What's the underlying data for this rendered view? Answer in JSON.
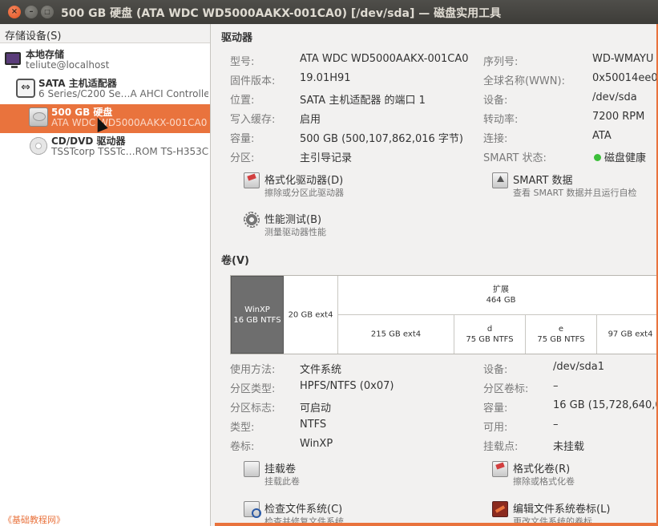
{
  "window": {
    "title": "500 GB 硬盘 (ATA WDC WD5000AAKX-001CA0) [/dev/sda] — 磁盘实用工具",
    "close_glyph": "×",
    "min_glyph": "–",
    "max_glyph": "□"
  },
  "sidebar": {
    "header": "存储设备(S)",
    "items": [
      {
        "title": "本地存储",
        "subtitle": "teliute@localhost",
        "icon": "monitor-icon"
      },
      {
        "title": "SATA 主机适配器",
        "subtitle": "6 Series/C200 Se…A AHCI Controller",
        "icon": "sata-adapter-icon"
      },
      {
        "title": "500 GB 硬盘",
        "subtitle": "ATA WDC WD5000AAKX-001CA0",
        "icon": "hard-disk-icon"
      },
      {
        "title": "CD/DVD 驱动器",
        "subtitle": "TSSTcorp TSSTc…ROM TS-H353C",
        "icon": "cdrom-icon"
      }
    ],
    "selected_index": 2,
    "sata_glyph": "⇔"
  },
  "drive": {
    "section_title": "驱动器",
    "left": [
      {
        "k": "型号:",
        "v": "ATA WDC WD5000AAKX-001CA0"
      },
      {
        "k": "固件版本:",
        "v": "19.01H91"
      },
      {
        "k": "位置:",
        "v": "SATA 主机适配器 的端口 1"
      },
      {
        "k": "写入缓存:",
        "v": "启用"
      },
      {
        "k": "容量:",
        "v": "500 GB (500,107,862,016 字节)"
      },
      {
        "k": "分区:",
        "v": "主引导记录"
      }
    ],
    "right": [
      {
        "k": "序列号:",
        "v": "WD-WMAYU"
      },
      {
        "k": "全球名称(WWN):",
        "v": "0x50014ee0"
      },
      {
        "k": "设备:",
        "v": "/dev/sda"
      },
      {
        "k": "转动率:",
        "v": "7200 RPM"
      },
      {
        "k": "连接:",
        "v": "ATA"
      },
      {
        "k": "SMART 状态:",
        "v": "磁盘健康"
      }
    ],
    "actions": [
      {
        "label": "格式化驱动器(D)",
        "desc": "擦除或分区此驱动器"
      },
      {
        "label": "SMART 数据",
        "desc": "查看 SMART 数据并且运行自检"
      },
      {
        "label": "性能测试(B)",
        "desc": "测量驱动器性能"
      }
    ],
    "smart_color": "#3cbf3a"
  },
  "volumes": {
    "section_title": "卷(V)",
    "partitions": [
      {
        "name": "WinXP",
        "size": "16 GB NTFS"
      },
      {
        "name": "",
        "size": "20 GB ext4"
      },
      {
        "name": "扩展",
        "size": "464 GB"
      },
      {
        "name": "",
        "size": "215 GB ext4"
      },
      {
        "name": "d",
        "size": "75 GB NTFS"
      },
      {
        "name": "e",
        "size": "75 GB NTFS"
      },
      {
        "name": "",
        "size": "97 GB ext4"
      }
    ],
    "left": [
      {
        "k": "使用方法:",
        "v": "文件系统"
      },
      {
        "k": "分区类型:",
        "v": "HPFS/NTFS (0x07)"
      },
      {
        "k": "分区标志:",
        "v": "可启动"
      },
      {
        "k": "类型:",
        "v": "NTFS"
      },
      {
        "k": "卷标:",
        "v": "WinXP"
      }
    ],
    "right": [
      {
        "k": "设备:",
        "v": "/dev/sda1"
      },
      {
        "k": "分区卷标:",
        "v": "–"
      },
      {
        "k": "容量:",
        "v": "16 GB (15,728,640,0"
      },
      {
        "k": "可用:",
        "v": "–"
      },
      {
        "k": "挂载点:",
        "v": "未挂载"
      }
    ],
    "actions": [
      {
        "label": "挂载卷",
        "desc": "挂载此卷"
      },
      {
        "label": "格式化卷(R)",
        "desc": "擦除或格式化卷"
      },
      {
        "label": "检查文件系统(C)",
        "desc": "检查并修复文件系统"
      },
      {
        "label": "编辑文件系统卷标(L)",
        "desc": "更改文件系统的卷标"
      }
    ]
  },
  "watermark": "《基础教程网》",
  "accent": "#e9733d"
}
